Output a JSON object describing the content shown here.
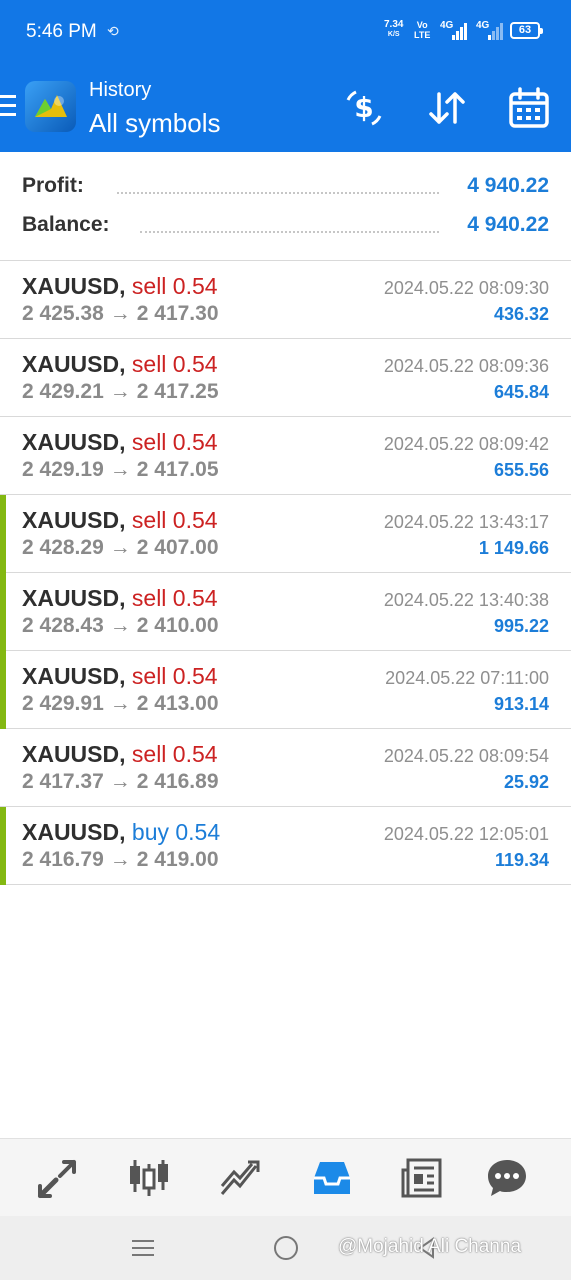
{
  "status_bar": {
    "time": "5:46 PM",
    "speed_value": "7.34",
    "speed_unit": "K/S",
    "volte_top": "Vo",
    "volte_bottom": "LTE",
    "sim1": "4G",
    "sim2": "4G",
    "battery": "63"
  },
  "header": {
    "subtitle": "History",
    "title": "All symbols",
    "icons": [
      "menu-icon",
      "app-logo",
      "dollar-exchange-icon",
      "sort-icon",
      "calendar-icon"
    ]
  },
  "summary": {
    "profit_label": "Profit:",
    "profit_value": "4 940.22",
    "balance_label": "Balance:",
    "balance_value": "4 940.22"
  },
  "deals": [
    {
      "symbol": "XAUUSD,",
      "type": "sell 0.54",
      "open": "2 425.38",
      "arrow": "→",
      "close": "2 417.30",
      "time": "2024.05.22 08:09:30",
      "profit": "436.32",
      "marker": false
    },
    {
      "symbol": "XAUUSD,",
      "type": "sell 0.54",
      "open": "2 429.21",
      "arrow": "→",
      "close": "2 417.25",
      "time": "2024.05.22 08:09:36",
      "profit": "645.84",
      "marker": false
    },
    {
      "symbol": "XAUUSD,",
      "type": "sell 0.54",
      "open": "2 429.19",
      "arrow": "→",
      "close": "2 417.05",
      "time": "2024.05.22 08:09:42",
      "profit": "655.56",
      "marker": false
    },
    {
      "symbol": "XAUUSD,",
      "type": "sell 0.54",
      "open": "2 428.29",
      "arrow": "→",
      "close": "2 407.00",
      "time": "2024.05.22 13:43:17",
      "profit": "1 149.66",
      "marker": true
    },
    {
      "symbol": "XAUUSD,",
      "type": "sell 0.54",
      "open": "2 428.43",
      "arrow": "→",
      "close": "2 410.00",
      "time": "2024.05.22 13:40:38",
      "profit": "995.22",
      "marker": true
    },
    {
      "symbol": "XAUUSD,",
      "type": "sell 0.54",
      "open": "2 429.91",
      "arrow": "→",
      "close": "2 413.00",
      "time": "2024.05.22 07:11:00",
      "profit": "913.14",
      "marker": true
    },
    {
      "symbol": "XAUUSD,",
      "type": "sell 0.54",
      "open": "2 417.37",
      "arrow": "→",
      "close": "2 416.89",
      "time": "2024.05.22 08:09:54",
      "profit": "25.92",
      "marker": false
    },
    {
      "symbol": "XAUUSD,",
      "type": "buy 0.54",
      "open": "2 416.79",
      "arrow": "→",
      "close": "2 419.00",
      "time": "2024.05.22 12:05:01",
      "profit": "119.34",
      "marker": true
    }
  ],
  "bottom_nav": [
    "quotes-icon",
    "chart-icon",
    "trade-icon",
    "history-icon",
    "news-icon",
    "messages-icon"
  ],
  "watermark": "@Mojahid Ali Channa",
  "colors": {
    "accent": "#1277e6",
    "profit": "#1c7dd8",
    "sell": "#cc2222",
    "marker": "#83b812"
  }
}
